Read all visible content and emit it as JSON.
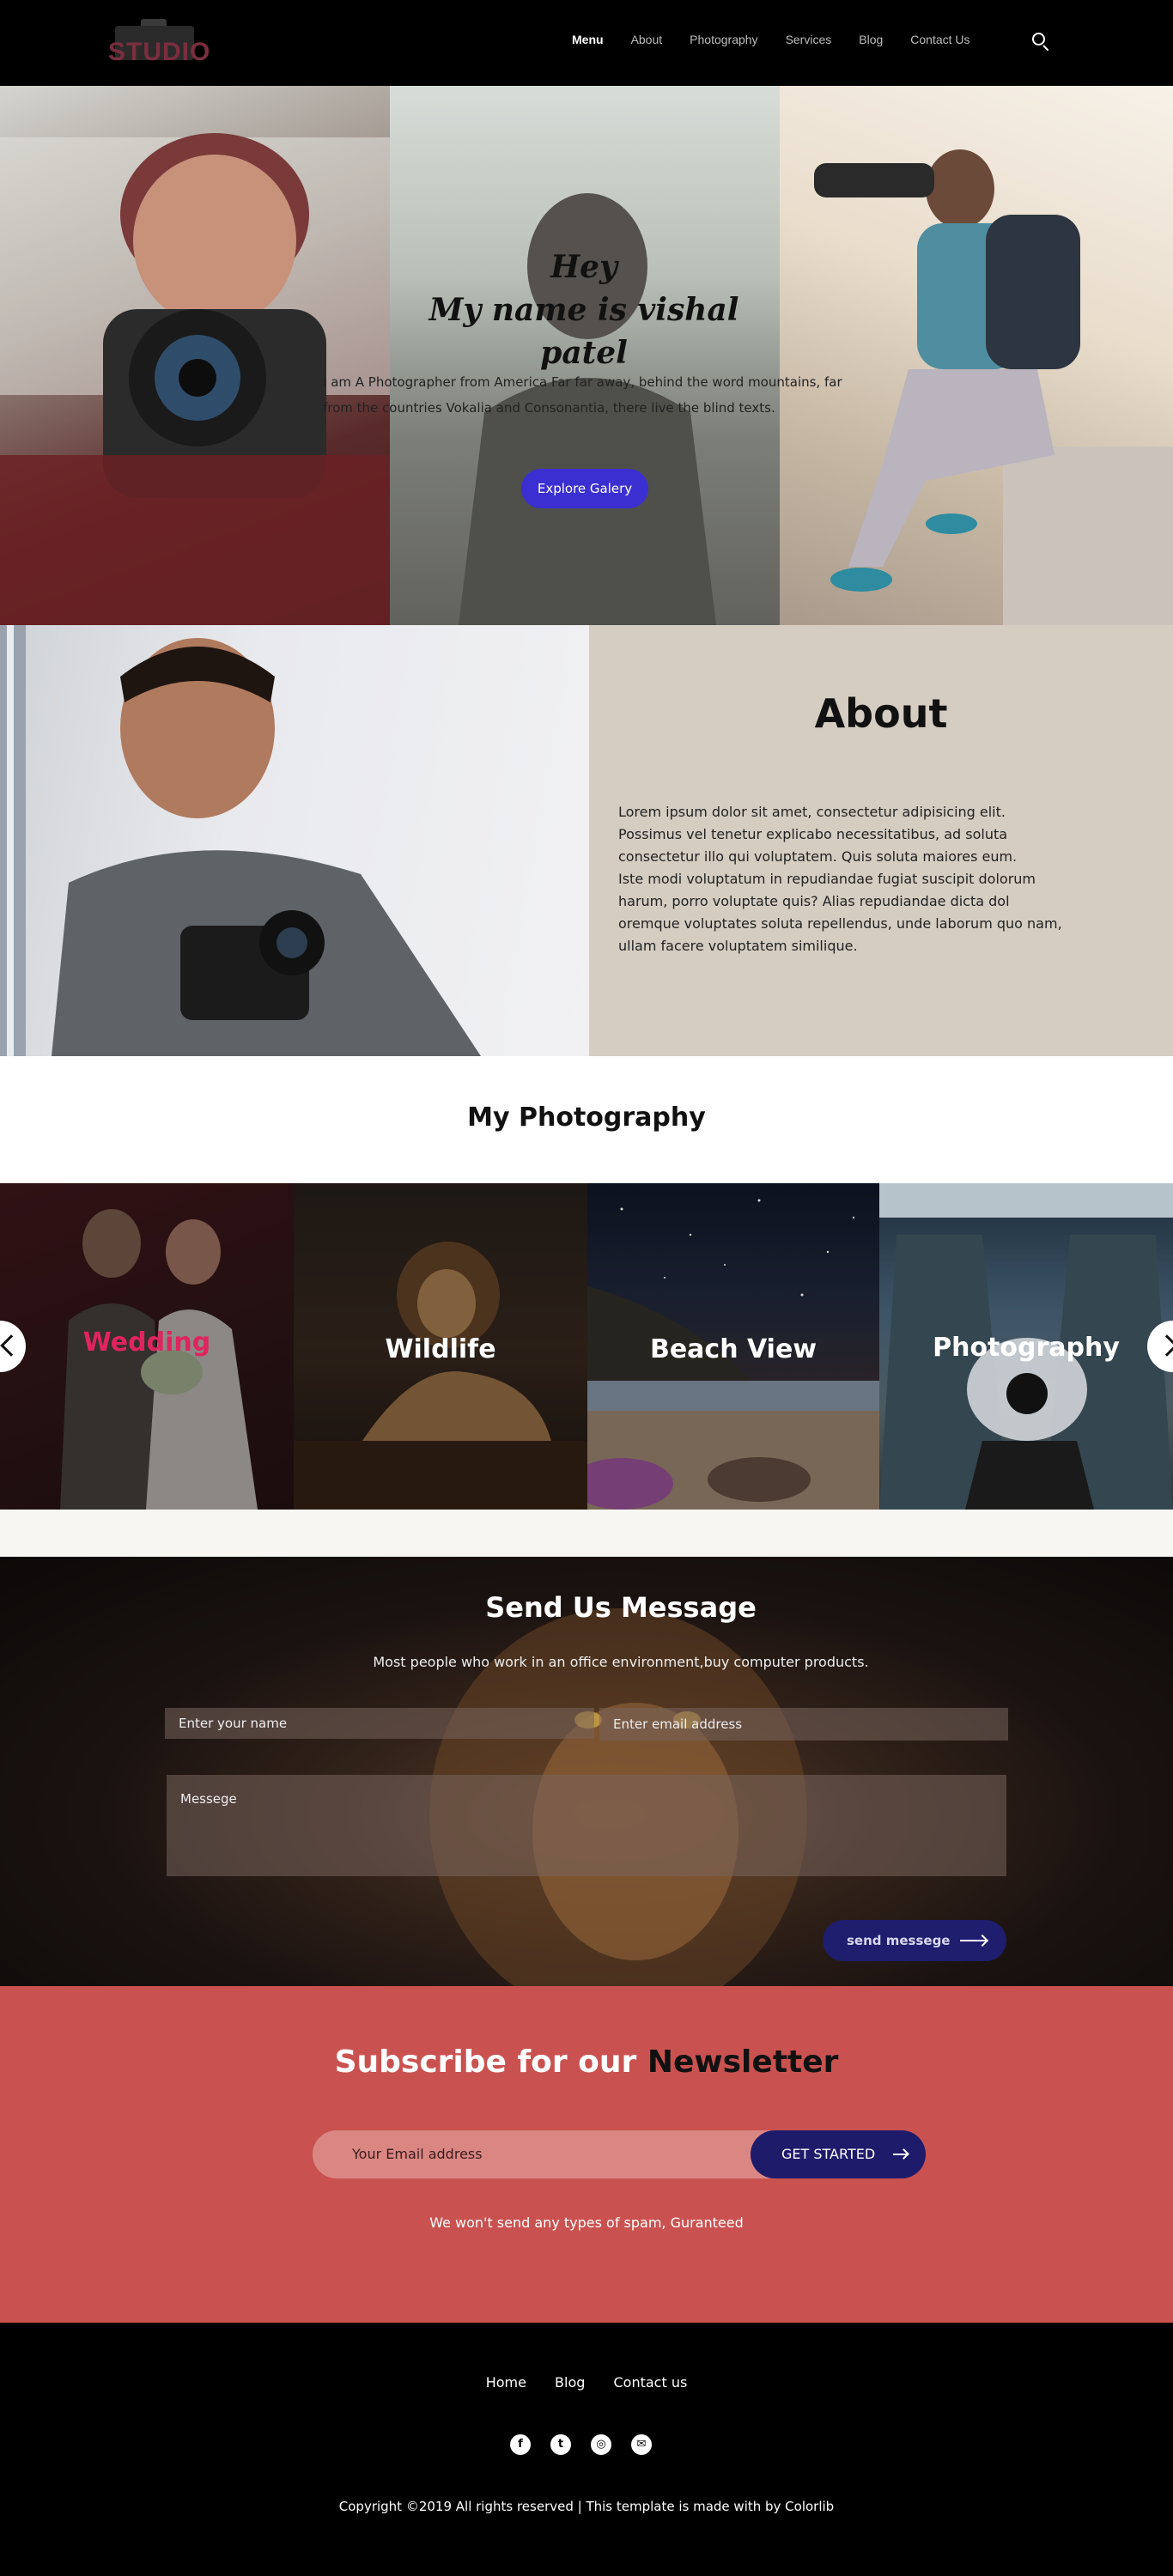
{
  "nav": {
    "logo_text": "STUDIO",
    "menu": [
      {
        "label": "Menu"
      },
      {
        "label": "About"
      },
      {
        "label": "Photography"
      },
      {
        "label": "Services"
      },
      {
        "label": "Blog"
      },
      {
        "label": "Contact Us"
      }
    ],
    "search_icon": "search-icon"
  },
  "hero": {
    "heading_line1": "Hey",
    "heading_line2": "My name is vishal patel",
    "description": "I am A Photographer from America Far far away, behind the word mountains, far from the countries Vokalia and Consonantia, there live the blind texts.",
    "button_label": "Explore Galery"
  },
  "about": {
    "title": "About",
    "text": "Lorem ipsum dolor sit amet, consectetur adipisicing elit.\nPossimus vel tenetur explicabo necessitatibus, ad soluta\n consectetur illo qui voluptatem. Quis soluta maiores eum.\nIste modi voluptatum in repudiandae fugiat suscipit dolorum\nharum, porro voluptate quis? Alias repudiandae dicta dol\noremque voluptates soluta repellendus, unde laborum quo nam,\n ullam facere voluptatem similique."
  },
  "photography": {
    "title": "My Photography",
    "tiles": [
      {
        "label": "Wedding",
        "label_color": "#e0245e"
      },
      {
        "label": "Wildlife",
        "label_color": "#ffffff"
      },
      {
        "label": "Beach View",
        "label_color": "#ffffff"
      },
      {
        "label": "Photography",
        "label_color": "#ffffff"
      }
    ]
  },
  "contact": {
    "title": "Send Us Message",
    "subtitle": "Most people who work in an office environment,buy computer products.",
    "name_placeholder": "Enter your name",
    "email_placeholder": "Enter email address",
    "message_placeholder": "Messege",
    "send_label": "send messege"
  },
  "newsletter": {
    "title_prefix": "Subscribe for our",
    "title_bold": "Newsletter",
    "email_placeholder": "Your Email address",
    "button_label": "GET STARTED",
    "note": "We won't send any types of spam, Guranteed"
  },
  "footer": {
    "links": [
      {
        "label": "Home"
      },
      {
        "label": "Blog"
      },
      {
        "label": "Contact us"
      }
    ],
    "socials": [
      {
        "icon": "facebook-icon"
      },
      {
        "icon": "twitter-icon"
      },
      {
        "icon": "instagram-icon"
      },
      {
        "icon": "email-icon"
      }
    ],
    "copyright": "Copyright ©2019 All rights reserved | This template is made with  by Colorlib"
  },
  "colors": {
    "accent_blue": "#3b2fd1",
    "navy_button": "#1e1b6a",
    "newsletter_bg": "#c95250",
    "about_panel_bg": "#d5cdc2",
    "wedding_pink": "#e0245e"
  }
}
